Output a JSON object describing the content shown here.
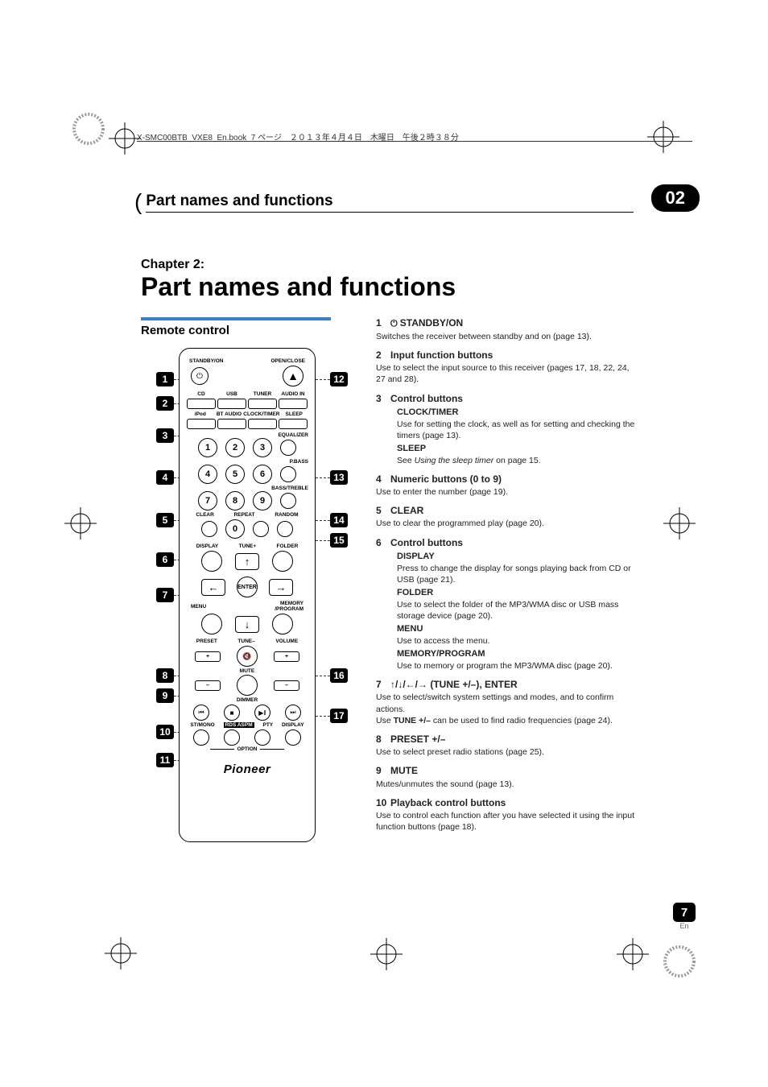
{
  "meta": {
    "filename": "X-SMC00BTB_VXE8_En.book",
    "page_info": "7 ページ　２０１３年４月４日　木曜日　午後２時３８分"
  },
  "header": {
    "title": "Part names and functions",
    "chapter_badge": "02"
  },
  "chapter": {
    "label": "Chapter 2:",
    "title": "Part names and functions"
  },
  "section": {
    "remote_heading": "Remote control"
  },
  "remote": {
    "standby_on": "STANDBY/ON",
    "open_close": "OPEN/CLOSE",
    "row1": [
      "CD",
      "USB",
      "TUNER",
      "AUDIO IN"
    ],
    "row2": [
      "iPod",
      "BT AUDIO",
      "CLOCK/TIMER",
      "SLEEP"
    ],
    "equalizer": "EQUALIZER",
    "pbass": "P.BASS",
    "bass_treble": "BASS/TREBLE",
    "clear": "CLEAR",
    "repeat": "REPEAT",
    "random": "RANDOM",
    "display": "DISPLAY",
    "tune_plus": "TUNE+",
    "folder": "FOLDER",
    "enter": "ENTER",
    "menu": "MENU",
    "memory_program": "MEMORY\n/PROGRAM",
    "preset": "PRESET",
    "tune_minus": "TUNE–",
    "volume": "VOLUME",
    "mute": "MUTE",
    "dimmer": "DIMMER",
    "lower_labels": [
      "ST/MONO",
      "RDS ASPM",
      "PTY",
      "DISPLAY"
    ],
    "option": "OPTION",
    "logo": "Pioneer",
    "nums": [
      "1",
      "2",
      "3",
      "4",
      "5",
      "6",
      "7",
      "8",
      "9",
      "0"
    ],
    "plus": "+",
    "minus": "–"
  },
  "callouts_left": [
    "1",
    "2",
    "3",
    "4",
    "5",
    "6",
    "7",
    "8",
    "9",
    "10",
    "11"
  ],
  "callouts_right": [
    "12",
    "13",
    "14",
    "15",
    "16",
    "17"
  ],
  "descriptions": {
    "d1": {
      "num": "1",
      "title": "STANDBY/ON",
      "text": "Switches the receiver between standby and on (page 13)."
    },
    "d2": {
      "num": "2",
      "title": "Input function buttons",
      "text": "Use to select the input source to this receiver (pages 17, 18, 22, 24, 27 and 28)."
    },
    "d3": {
      "num": "3",
      "title": "Control buttons",
      "sub1_head": "CLOCK/TIMER",
      "sub1_text": "Use for setting the clock, as well as for setting and checking the timers (page 13).",
      "sub2_head": "SLEEP",
      "sub2_pre": "See ",
      "sub2_em": "Using the sleep timer",
      "sub2_post": " on page 15."
    },
    "d4": {
      "num": "4",
      "title": "Numeric buttons (0 to 9)",
      "text": "Use to enter the number (page 19)."
    },
    "d5": {
      "num": "5",
      "title": "CLEAR",
      "text": "Use to clear the programmed play (page 20)."
    },
    "d6": {
      "num": "6",
      "title": "Control buttons",
      "s1h": "DISPLAY",
      "s1t": "Press to change the display for songs playing back from CD or USB (page 21).",
      "s2h": "FOLDER",
      "s2t": "Use to select the folder of the MP3/WMA disc or USB mass storage device (page 20).",
      "s3h": "MENU",
      "s3t": "Use to access the menu.",
      "s4h": "MEMORY/PROGRAM",
      "s4t": "Use to memory or program the MP3/WMA disc (page 20)."
    },
    "d7": {
      "num": "7",
      "title_arrows": "↑/↓/←/→ (TUNE +/–), ENTER",
      "text1": "Use to select/switch system settings and modes, and to confirm actions.",
      "text2a": "Use ",
      "text2b": "TUNE +/–",
      "text2c": " can be used to find radio frequencies (page 24)."
    },
    "d8": {
      "num": "8",
      "title": "PRESET +/–",
      "text": "Use to select preset radio stations (page 25)."
    },
    "d9": {
      "num": "9",
      "title": "MUTE",
      "text": "Mutes/unmutes the sound (page 13)."
    },
    "d10": {
      "num": "10",
      "title": "Playback control buttons",
      "text": "Use to control each function after you have selected it using the input function buttons (page 18)."
    }
  },
  "footer": {
    "page": "7",
    "lang": "En"
  }
}
